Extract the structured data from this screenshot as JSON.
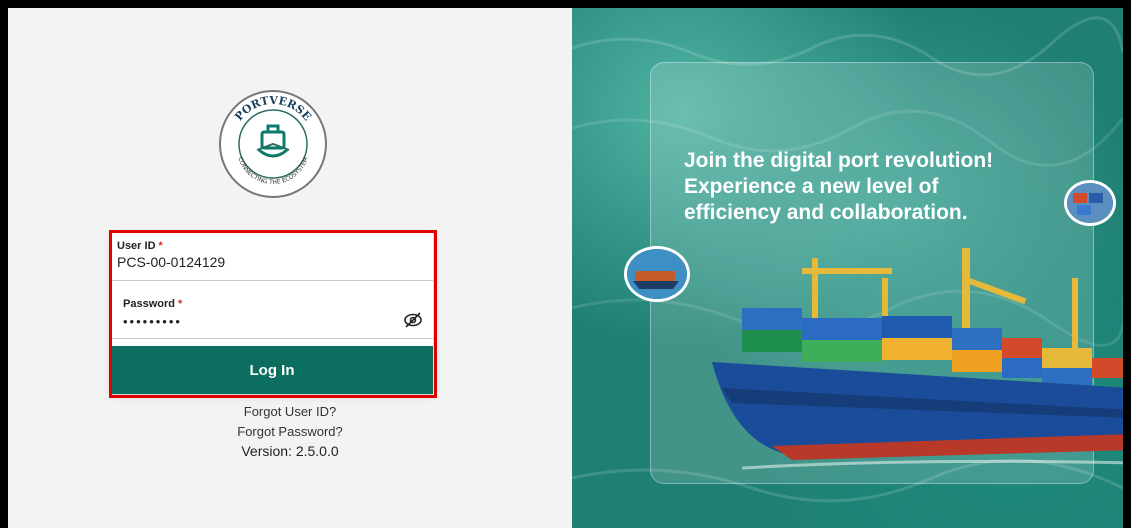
{
  "logo": {
    "brand": "PORTVERSE",
    "tagline": "CONNECTING THE ECOSYSTEM"
  },
  "form": {
    "user_id_label": "User ID",
    "user_id_value": "PCS-00-0124129",
    "password_label": "Password",
    "password_value": "•••••••••",
    "required_mark": "*",
    "login_label": "Log In"
  },
  "links": {
    "forgot_user_id": "Forgot User ID?",
    "forgot_password": "Forgot Password?",
    "version": "Version: 2.5.0.0"
  },
  "hero": {
    "headline_line1": "Join the digital port revolution!",
    "headline_line2": "Experience a new level of",
    "headline_line3": "efficiency and collaboration."
  },
  "colors": {
    "primary": "#0b6e5f",
    "highlight": "#e00000",
    "sea": "#1e7f72"
  }
}
